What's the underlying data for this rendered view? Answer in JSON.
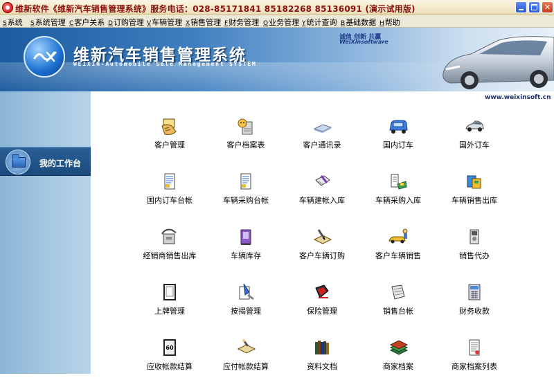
{
  "window": {
    "title": "维新软件《维新汽车销售管理系统》服务电话：028-85171841  85182268  85136091 (演示试用版)"
  },
  "menu": [
    {
      "key": "S",
      "label": "系统"
    },
    {
      "key": "S",
      "label": "系统管理"
    },
    {
      "key": "C",
      "label": "客户关系"
    },
    {
      "key": "D",
      "label": "订购管理"
    },
    {
      "key": "V",
      "label": "车辆管理"
    },
    {
      "key": "X",
      "label": "销售管理"
    },
    {
      "key": "F",
      "label": "财务管理"
    },
    {
      "key": "O",
      "label": "业务管理"
    },
    {
      "key": "Y",
      "label": "统计查询"
    },
    {
      "key": "B",
      "label": "基础数据"
    },
    {
      "key": "H",
      "label": "帮助"
    }
  ],
  "banner": {
    "title": "维新汽车销售管理系统",
    "subtitle": "WEIXIN-Automobile Sale Management SYSTEM",
    "slogan": "诚信  创新  共赢",
    "company": "WeiXinsoftware",
    "website": "www.weixinsoft.cn"
  },
  "sidebar": {
    "workspace_label": "我的工作台"
  },
  "tiles": [
    {
      "label": "客户管理",
      "icon": "hand-card-icon"
    },
    {
      "label": "客户档案表",
      "icon": "user-profile-icon"
    },
    {
      "label": "客户通讯录",
      "icon": "address-book-icon"
    },
    {
      "label": "国内订车",
      "icon": "blue-car-icon"
    },
    {
      "label": "国外订车",
      "icon": "silver-car-icon"
    },
    {
      "label": "国内订车台帐",
      "icon": "ledger-document-icon"
    },
    {
      "label": "车辆采购台帐",
      "icon": "ledger-document-icon"
    },
    {
      "label": "车辆建帐入库",
      "icon": "write-document-icon"
    },
    {
      "label": "车辆采购入库",
      "icon": "warehouse-in-icon"
    },
    {
      "label": "车辆销售出库",
      "icon": "warehouse-out-icon"
    },
    {
      "label": "经销商销售出库",
      "icon": "dealer-phone-icon"
    },
    {
      "label": "车辆库存",
      "icon": "inventory-box-icon"
    },
    {
      "label": "客户车辆订购",
      "icon": "order-pen-icon"
    },
    {
      "label": "客户车辆销售",
      "icon": "sales-delivery-icon"
    },
    {
      "label": "销售代办",
      "icon": "agent-phone-icon"
    },
    {
      "label": "上牌管理",
      "icon": "license-frame-icon"
    },
    {
      "label": "按揭管理",
      "icon": "mortgage-icon"
    },
    {
      "label": "保险管理",
      "icon": "insurance-shield-icon"
    },
    {
      "label": "销售台帐",
      "icon": "sales-ledger-icon"
    },
    {
      "label": "财务收款",
      "icon": "calculator-icon"
    },
    {
      "label": "应收帐款结算",
      "icon": "receivable-calendar-icon"
    },
    {
      "label": "应付帐款结算",
      "icon": "payable-hand-icon"
    },
    {
      "label": "资料文档",
      "icon": "bookshelf-icon"
    },
    {
      "label": "商家档案",
      "icon": "merchant-books-icon"
    },
    {
      "label": "商家档案列表",
      "icon": "merchant-list-icon"
    }
  ]
}
